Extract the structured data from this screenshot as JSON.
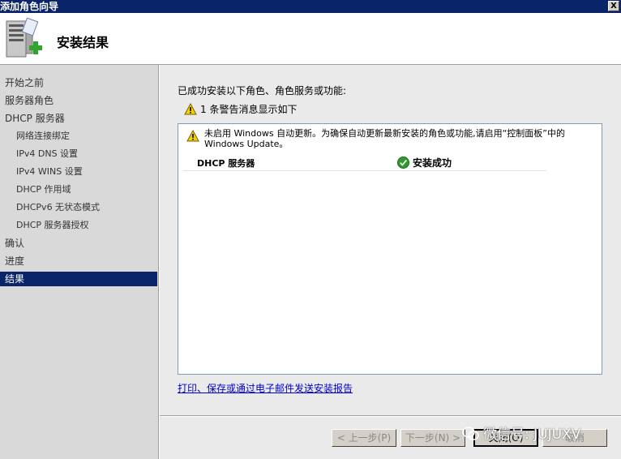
{
  "window": {
    "title": "添加角色向导",
    "close_glyph": "X"
  },
  "header": {
    "title": "安装结果",
    "icon": "server-add-icon"
  },
  "sidebar": {
    "items": [
      {
        "label": "开始之前",
        "level": 0,
        "active": false
      },
      {
        "label": "服务器角色",
        "level": 0,
        "active": false
      },
      {
        "label": "DHCP 服务器",
        "level": 0,
        "active": false
      },
      {
        "label": "网络连接绑定",
        "level": 1,
        "active": false
      },
      {
        "label": "IPv4 DNS 设置",
        "level": 1,
        "active": false
      },
      {
        "label": "IPv4 WINS 设置",
        "level": 1,
        "active": false
      },
      {
        "label": "DHCP 作用域",
        "level": 1,
        "active": false
      },
      {
        "label": "DHCPv6 无状态模式",
        "level": 1,
        "active": false
      },
      {
        "label": "DHCP 服务器授权",
        "level": 1,
        "active": false
      },
      {
        "label": "确认",
        "level": 0,
        "active": false
      },
      {
        "label": "进度",
        "level": 0,
        "active": false
      },
      {
        "label": "结果",
        "level": 0,
        "active": true
      }
    ]
  },
  "main": {
    "intro": "已成功安装以下角色、角色服务或功能:",
    "warning_summary": "1 条警告消息显示如下",
    "results": {
      "message": "未启用 Windows 自动更新。为确保自动更新最新安装的角色或功能,请启用“控制面板”中的 Windows Update。",
      "rows": [
        {
          "name": "DHCP 服务器",
          "status": "安装成功"
        }
      ]
    },
    "report_link": "打印、保存或通过电子邮件发送安装报告"
  },
  "buttons": {
    "back": "< 上一步(P)",
    "next": "下一步(N) >",
    "close": "关闭(O)",
    "cancel": "取消"
  },
  "watermark": "微信号: JUJUXV",
  "colors": {
    "title_bar": "#0a246a",
    "sidebar": "#d9d9d9",
    "active_nav": "#0a246a",
    "link": "#0000cc"
  }
}
